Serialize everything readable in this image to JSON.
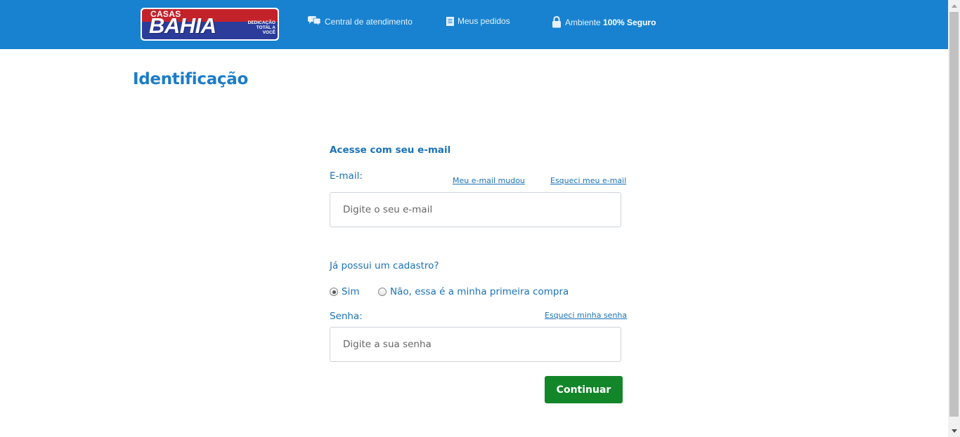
{
  "header": {
    "logo": {
      "top": "CASAS",
      "main": "BAHIA",
      "tagline": [
        "DEDICAÇÃO",
        "TOTAL A",
        "VOCÊ"
      ]
    },
    "links": [
      {
        "label": "Central de atendimento",
        "icon": "chat-bubbles-icon"
      },
      {
        "label": "Meus pedidos",
        "icon": "document-icon"
      }
    ],
    "security": {
      "prefix": "Ambiente ",
      "bold": "100% Seguro",
      "icon": "lock-icon"
    },
    "bg_color": "#1882d0"
  },
  "page": {
    "title": "Identificação"
  },
  "form": {
    "section_title": "Acesse com seu e-mail",
    "email": {
      "label": "E-mail:",
      "placeholder": "Digite o seu e-mail",
      "link_changed": "Meu e-mail mudou",
      "link_forgot": "Esqueci meu e-mail"
    },
    "question": "Já possui um cadastro?",
    "radios": [
      {
        "label": "Sim",
        "checked": true
      },
      {
        "label": "Não, essa é a minha primeira compra",
        "checked": false
      }
    ],
    "password": {
      "label": "Senha:",
      "placeholder": "Digite a sua senha",
      "link_forgot": "Esqueci minha senha"
    },
    "submit_label": "Continuar",
    "submit_color": "#14862a"
  }
}
